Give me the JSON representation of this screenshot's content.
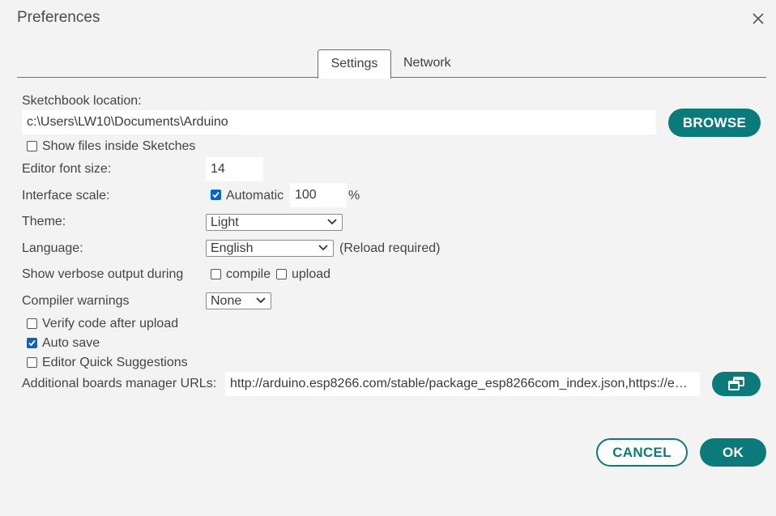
{
  "window": {
    "title": "Preferences"
  },
  "tabs": [
    {
      "label": "Settings"
    },
    {
      "label": "Network"
    }
  ],
  "settings": {
    "sketchbook_label": "Sketchbook location:",
    "sketchbook_path": "c:\\Users\\LW10\\Documents\\Arduino",
    "browse_label": "BROWSE",
    "show_files_label": "Show files inside Sketches",
    "show_files_checked": false,
    "font_size_label": "Editor font size:",
    "font_size_value": "14",
    "interface_scale_label": "Interface scale:",
    "automatic_label": "Automatic",
    "automatic_checked": true,
    "scale_value": "100",
    "scale_unit": "%",
    "theme_label": "Theme:",
    "theme_value": "Light",
    "language_label": "Language:",
    "language_value": "English",
    "language_note": "(Reload required)",
    "verbose_label": "Show verbose output during",
    "compile_label": "compile",
    "compile_checked": false,
    "upload_label": "upload",
    "upload_checked": false,
    "compiler_warnings_label": "Compiler warnings",
    "compiler_warnings_value": "None",
    "verify_label": "Verify code after upload",
    "verify_checked": false,
    "autosave_label": "Auto save",
    "autosave_checked": true,
    "quick_suggestions_label": "Editor Quick Suggestions",
    "quick_suggestions_checked": false,
    "boards_urls_label": "Additional boards manager URLs:",
    "boards_urls_value": "http://arduino.esp8266.com/stable/package_esp8266com_index.json,https://e…"
  },
  "footer": {
    "cancel_label": "CANCEL",
    "ok_label": "OK"
  },
  "colors": {
    "accent": "#0b7a7a",
    "checkbox": "#0b63c5",
    "background": "#f3f3f3"
  },
  "icons": {
    "close": "close-icon",
    "chevron": "chevron-down-icon",
    "open_window": "open-window-icon"
  }
}
